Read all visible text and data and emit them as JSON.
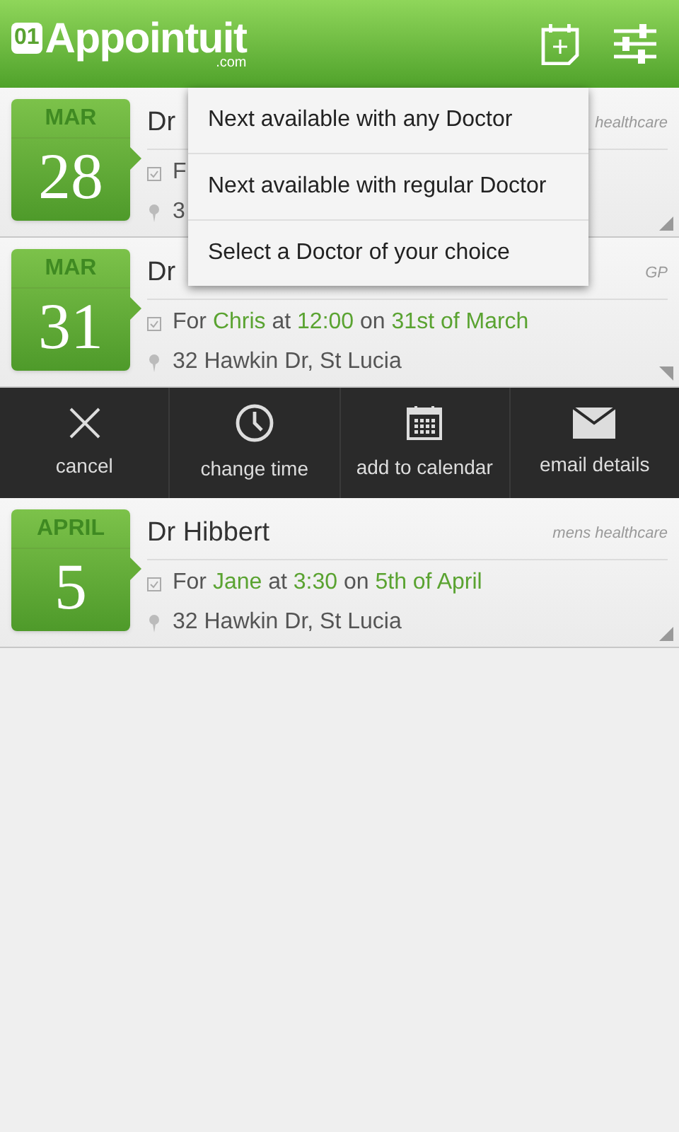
{
  "header": {
    "logo_badge": "01",
    "logo_text": "Appointuit",
    "logo_suffix": ".com"
  },
  "appointments": [
    {
      "month": "MAR",
      "day": "28",
      "doctor": "Dr",
      "specialty": "healthcare",
      "detail": [
        {
          "text": "F",
          "highlight": false
        }
      ],
      "address": "3",
      "expanded": false
    },
    {
      "month": "MAR",
      "day": "31",
      "doctor": "Dr",
      "specialty": "GP",
      "detail": [
        {
          "text": "For ",
          "highlight": false
        },
        {
          "text": "Chris",
          "highlight": true
        },
        {
          "text": " at ",
          "highlight": false
        },
        {
          "text": "12:00",
          "highlight": true
        },
        {
          "text": " on ",
          "highlight": false
        },
        {
          "text": "31st of March",
          "highlight": true
        }
      ],
      "address": "32 Hawkin Dr, St Lucia",
      "expanded": true
    },
    {
      "month": "APRIL",
      "day": "5",
      "doctor": "Dr Hibbert",
      "specialty": "mens healthcare",
      "detail": [
        {
          "text": "For ",
          "highlight": false
        },
        {
          "text": "Jane",
          "highlight": true
        },
        {
          "text": " at ",
          "highlight": false
        },
        {
          "text": "3:30",
          "highlight": true
        },
        {
          "text": " on ",
          "highlight": false
        },
        {
          "text": "5th of April",
          "highlight": true
        }
      ],
      "address": "32 Hawkin Dr, St Lucia",
      "expanded": false
    }
  ],
  "actions": [
    {
      "kind": "cancel",
      "label": "cancel"
    },
    {
      "kind": "time",
      "label": "change time"
    },
    {
      "kind": "calendar",
      "label": "add to calendar"
    },
    {
      "kind": "email",
      "label": "email details"
    }
  ],
  "menu": [
    "Next available with any Doctor",
    "Next available with regular Doctor",
    "Select a Doctor of your choice"
  ]
}
